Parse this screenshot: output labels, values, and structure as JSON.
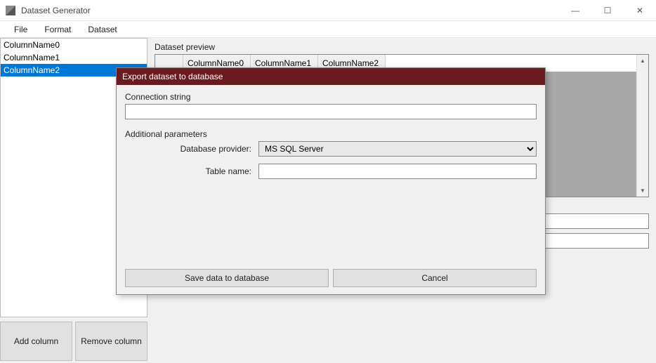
{
  "window": {
    "title": "Dataset Generator",
    "controls": {
      "min": "—",
      "max": "☐",
      "close": "✕"
    }
  },
  "menu": {
    "items": [
      "File",
      "Format",
      "Dataset"
    ]
  },
  "columns": {
    "list": [
      "ColumnName0",
      "ColumnName1",
      "ColumnName2"
    ],
    "selected_index": 2,
    "add_label": "Add column",
    "remove_label": "Remove column"
  },
  "preview": {
    "label": "Dataset preview",
    "headers": [
      "ColumnName0",
      "ColumnName1",
      "ColumnName2"
    ]
  },
  "dialog": {
    "title": "Export dataset to database",
    "connection_label": "Connection string",
    "connection_value": "",
    "additional_label": "Additional parameters",
    "provider_label": "Database provider:",
    "provider_value": "MS SQL Server",
    "table_label": "Table name:",
    "table_value": "",
    "save_label": "Save data to database",
    "cancel_label": "Cancel"
  }
}
